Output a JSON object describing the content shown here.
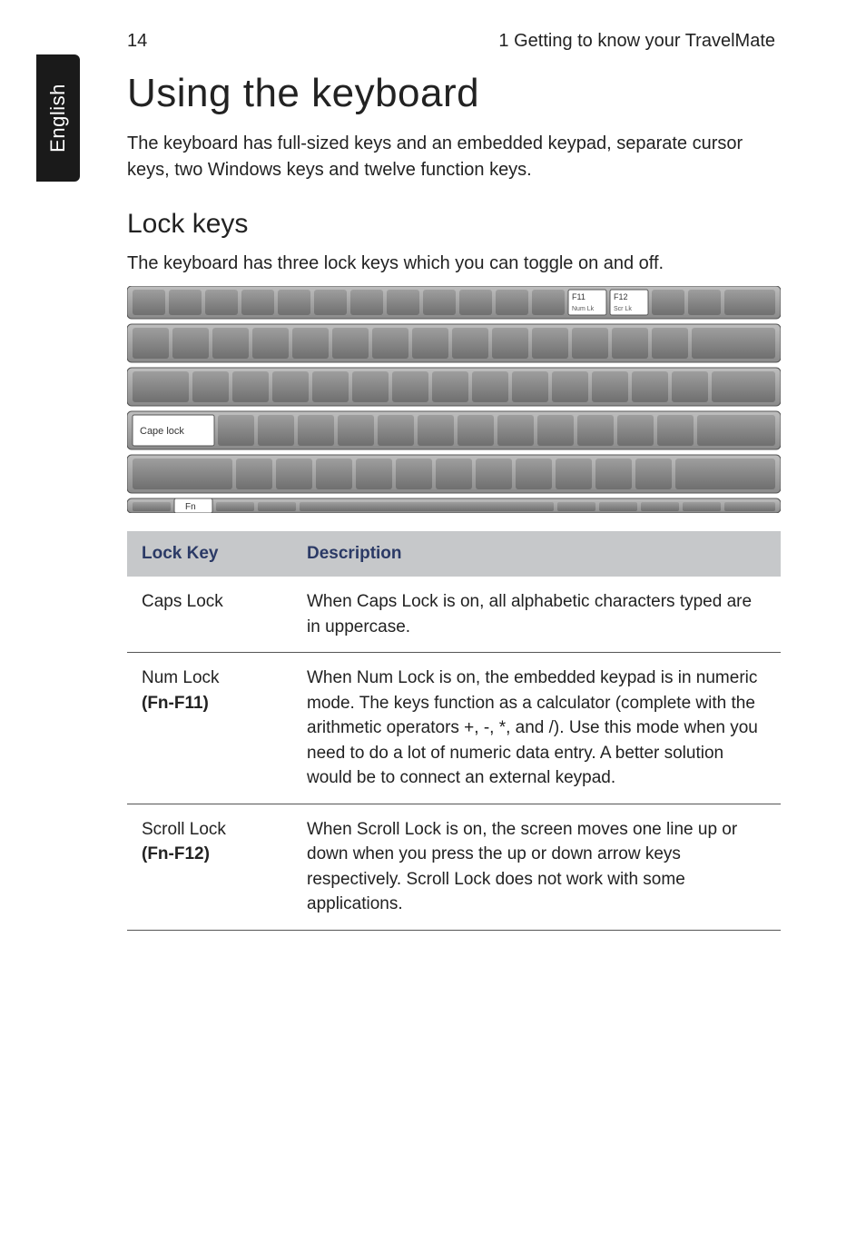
{
  "page_number": "14",
  "chapter_header": "1 Getting to know your TravelMate",
  "side_tab": "English",
  "h1": "Using the keyboard",
  "intro": "The keyboard has full-sized keys and an embedded keypad, separate cursor keys, two Windows keys and twelve function keys.",
  "h2": "Lock keys",
  "subintro": "The keyboard has three lock keys which you can toggle on and off.",
  "keyboard_labels": {
    "f11_top": "F11",
    "f11_sub": "Num Lk",
    "f12_top": "F12",
    "f12_sub": "Scr Lk",
    "caps": "Cape lock",
    "fn": "Fn"
  },
  "table": {
    "head_key": "Lock Key",
    "head_desc": "Description",
    "rows": [
      {
        "key": "Caps Lock",
        "sub": "",
        "desc": "When Caps Lock is on, all alphabetic characters typed are in uppercase."
      },
      {
        "key": "Num Lock",
        "sub": "(Fn-F11)",
        "desc": "When Num Lock is on, the embedded keypad is in numeric mode. The keys function as a calculator (complete with the arithmetic operators +, -, *, and /). Use this mode when you need to do a lot of numeric data entry. A better solution would be to connect an external keypad."
      },
      {
        "key": "Scroll Lock",
        "sub": "(Fn-F12)",
        "desc": "When Scroll Lock is on, the screen moves one line up or down when you press the up or down arrow keys respectively. Scroll Lock does not work with some applications."
      }
    ]
  }
}
